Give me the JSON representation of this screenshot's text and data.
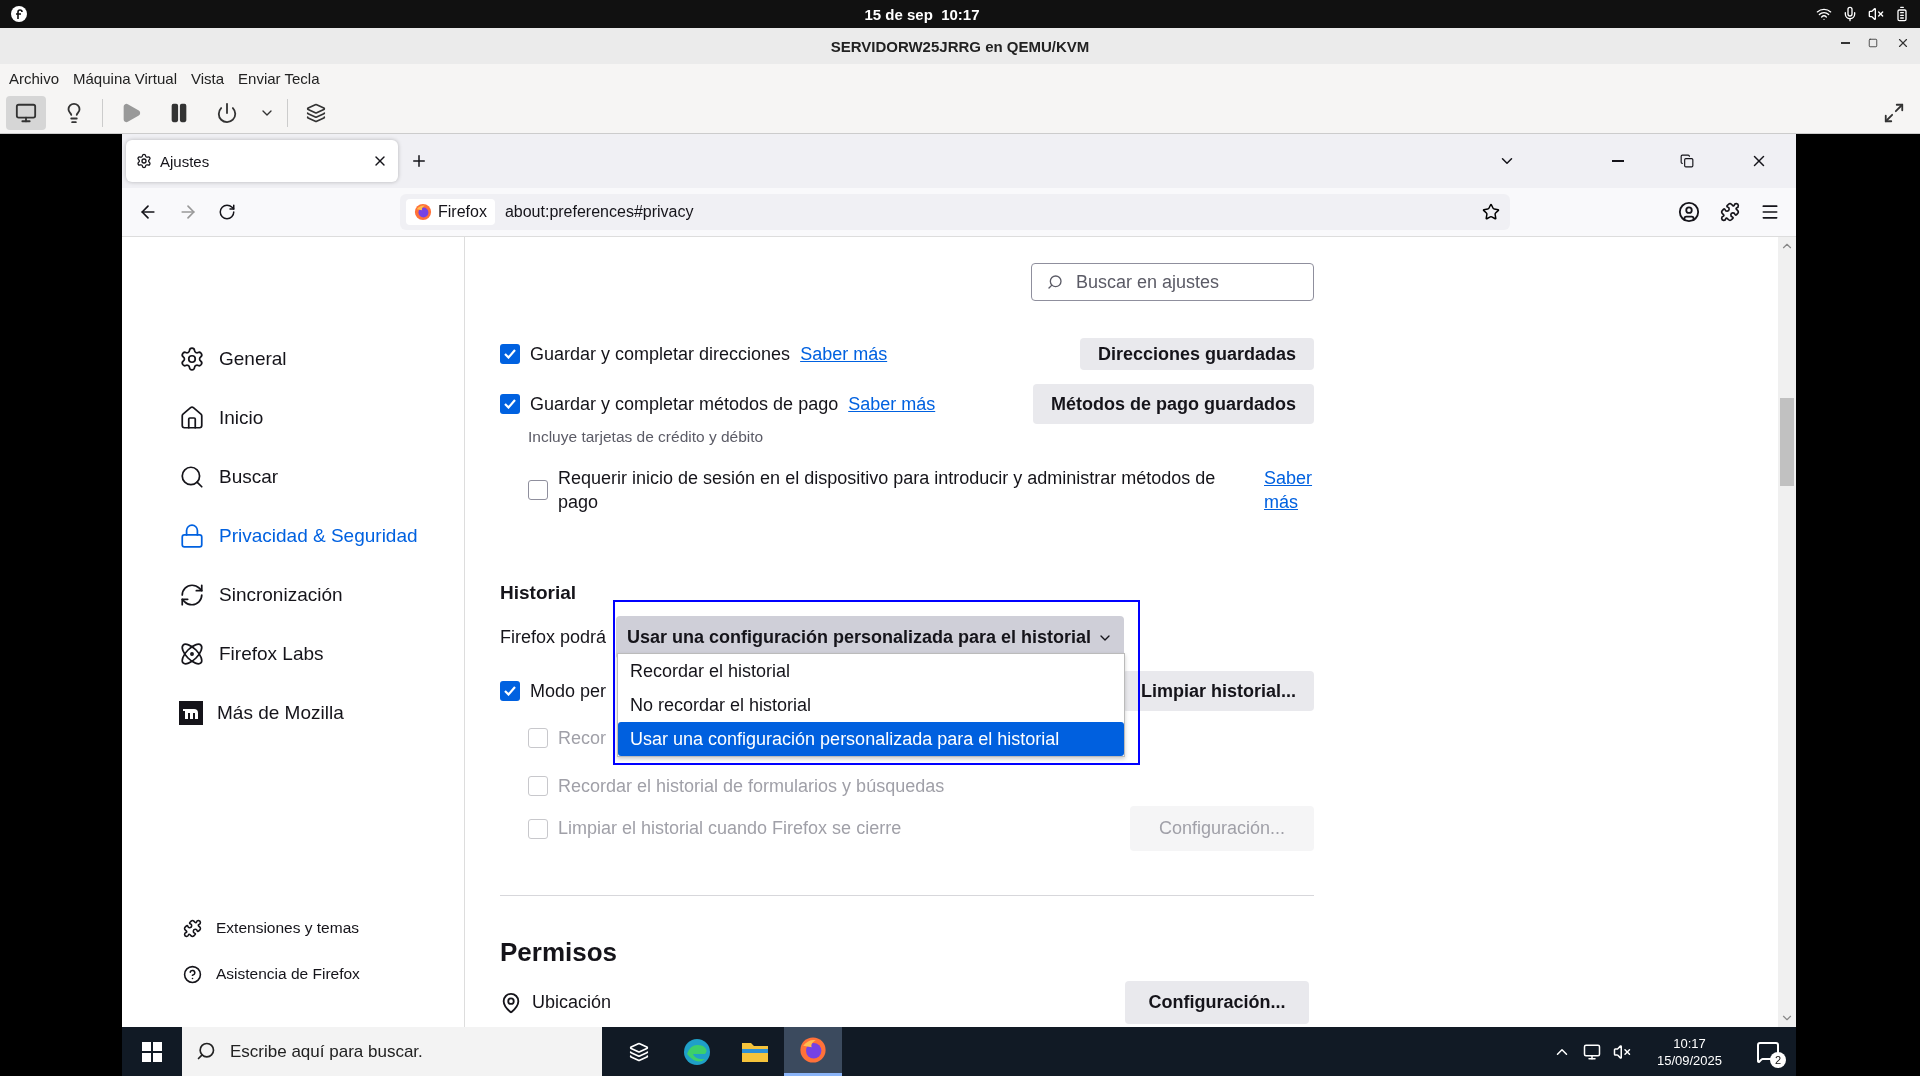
{
  "topbar": {
    "clock": "15 de sep  10:17"
  },
  "vm_window": {
    "title": "SERVIDORW25JRRG en QEMU/KVM",
    "menu": [
      "Archivo",
      "Máquina Virtual",
      "Vista",
      "Enviar Tecla"
    ]
  },
  "browser": {
    "tabs": [
      {
        "label": "Ajustes",
        "selected": true
      }
    ],
    "identity": "Firefox",
    "url": "about:preferences#privacy"
  },
  "sidebar": {
    "items": [
      {
        "label": "General",
        "selected": false
      },
      {
        "label": "Inicio",
        "selected": false
      },
      {
        "label": "Buscar",
        "selected": false
      },
      {
        "label": "Privacidad & Seguridad",
        "selected": true
      },
      {
        "label": "Sincronización",
        "selected": false
      },
      {
        "label": "Firefox Labs",
        "selected": false
      },
      {
        "label": "Más de Mozilla",
        "selected": false
      }
    ],
    "footer": [
      "Extensiones y temas",
      "Asistencia de Firefox"
    ]
  },
  "search": {
    "placeholder": "Buscar en ajustes"
  },
  "autofill": [
    {
      "label": "Guardar y completar direcciones",
      "checked": true,
      "link": "Saber más",
      "button": "Direcciones guardadas"
    },
    {
      "label": "Guardar y completar métodos de pago",
      "checked": true,
      "link": "Saber más",
      "button": "Métodos de pago guardados",
      "note": "Incluye tarjetas de crédito y débito"
    }
  ],
  "require_login": {
    "label": "Requerir inicio de sesión en el dispositivo para introducir y administrar métodos de pago",
    "checked": false,
    "link": "Saber más"
  },
  "history": {
    "heading": "Historial",
    "label": "Firefox podrá",
    "value": "Usar una configuración personalizada para el historial",
    "options": [
      {
        "label": "Recordar el historial",
        "selected": false
      },
      {
        "label": "No recordar el historial",
        "selected": false
      },
      {
        "label": "Usar una configuración personalizada para el historial",
        "selected": true
      }
    ],
    "private_mode": {
      "label": "Modo per",
      "checked": true
    },
    "clear_button": "Limpiar historial...",
    "options_checks": [
      {
        "label": "Recor",
        "checked": false,
        "disabled": true
      },
      {
        "label": "Recordar el historial de formularios y búsquedas",
        "checked": false,
        "disabled": true
      },
      {
        "label": "Limpiar el historial cuando Firefox se cierre",
        "checked": false,
        "disabled": true
      }
    ],
    "settings_button": {
      "label": "Configuración...",
      "disabled": true
    }
  },
  "permissions": {
    "heading": "Permisos",
    "items": [
      {
        "label": "Ubicación",
        "button": "Configuración..."
      }
    ]
  },
  "taskbar": {
    "search_placeholder": "Escribe aquí para buscar.",
    "time": "10:17",
    "date": "15/09/2025",
    "notifications": "2"
  }
}
